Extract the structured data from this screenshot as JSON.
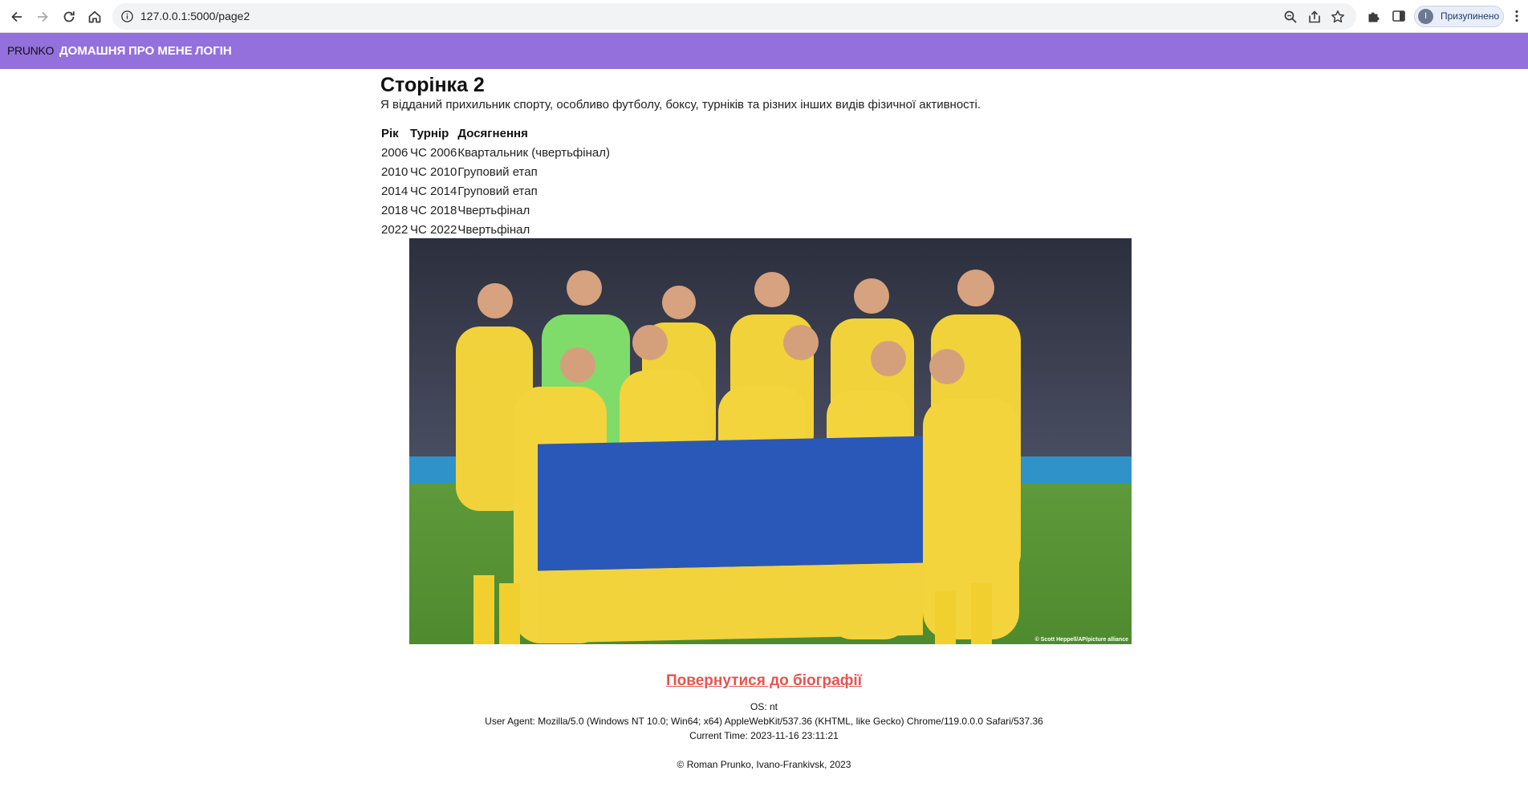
{
  "browser": {
    "url": "127.0.0.1:5000/page2",
    "profile_label": "Призупинено",
    "profile_initial": "I"
  },
  "navbar": {
    "brand": "PRUNKO",
    "links": [
      "ДОМАШНЯ",
      "ПРО МЕНЕ",
      "ЛОГІН"
    ],
    "background": "#9370db"
  },
  "main": {
    "title": "Сторінка 2",
    "intro": "Я відданий прихильник спорту, особливо футболу, боксу, турніків та різних інших видів фізичної активності.",
    "table": {
      "headers": [
        "Рік",
        "Турнір",
        "Досягнення"
      ],
      "rows": [
        [
          "2006",
          "ЧС 2006",
          "Квартальник (чвертьфінал)"
        ],
        [
          "2010",
          "ЧС 2010",
          "Груповий етап"
        ],
        [
          "2014",
          "ЧС 2014",
          "Груповий етап"
        ],
        [
          "2018",
          "ЧС 2018",
          "Чвертьфінал"
        ],
        [
          "2022",
          "ЧС 2022",
          "Чвертьфінал"
        ]
      ]
    },
    "photo_credit": "© Scott Heppell/AP/picture alliance"
  },
  "footer": {
    "back_link": "Повернутися до біографії",
    "os": "OS: nt",
    "user_agent": "User Agent: Mozilla/5.0 (Windows NT 10.0; Win64; x64) AppleWebKit/537.36 (KHTML, like Gecko) Chrome/119.0.0.0 Safari/537.36",
    "current_time": "Current Time: 2023-11-16 23:11:21",
    "copyright": "© Roman Prunko, Ivano-Frankivsk, 2023",
    "link_color": "#e5554f"
  }
}
